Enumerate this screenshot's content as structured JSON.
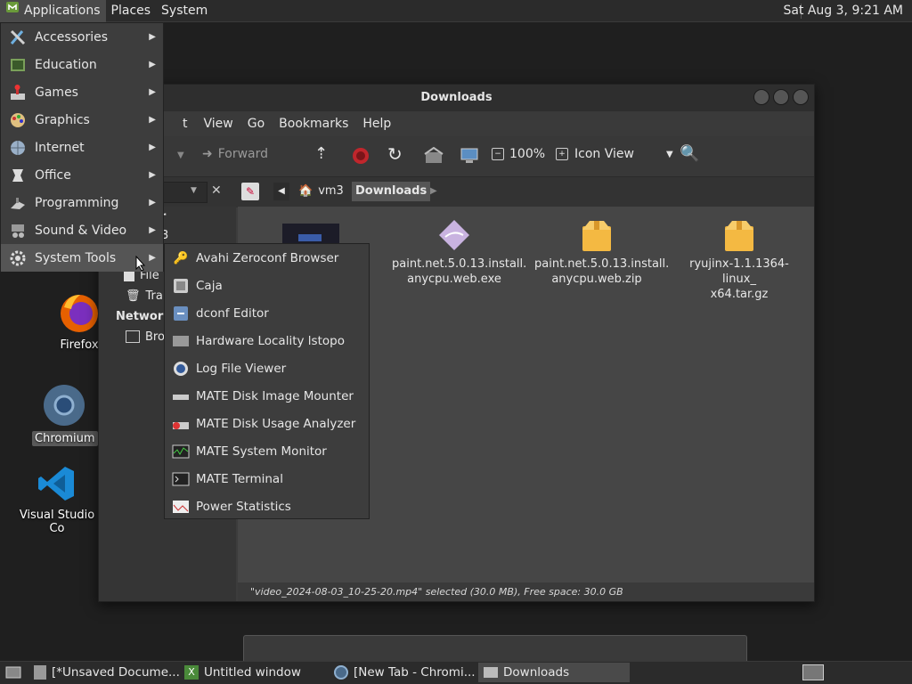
{
  "topbar": {
    "applications": "Applications",
    "places": "Places",
    "system": "System",
    "clock": "Sat Aug  3,  9:21 AM"
  },
  "desktop": {
    "firefox": "Firefox",
    "chromium": "Chromium",
    "vscode": "Visual Studio Co"
  },
  "window": {
    "title": "Downloads",
    "menu": [
      "t",
      "View",
      "Go",
      "Bookmarks",
      "Help"
    ],
    "toolbar": {
      "forward": "Forward",
      "zoom": "100%",
      "view_mode": "Icon View"
    },
    "location": {
      "crumbs": [
        "vm3",
        "Downloads"
      ]
    },
    "sidebar": {
      "items": [
        "er",
        "3",
        "File",
        "Tra"
      ],
      "network_header": "Network",
      "network_item": "Bro"
    },
    "files": [
      {
        "name": "paint.net.5.0.13.install.\nanycpu.web.exe",
        "kind": "exe"
      },
      {
        "name": "paint.net.5.0.13.install.\nanycpu.web.zip",
        "kind": "archive"
      },
      {
        "name": "ryujinx-1.1.1364-linux_\nx64.tar.gz",
        "kind": "archive"
      }
    ],
    "status": "\"video_2024-08-03_10-25-20.mp4\" selected (30.0 MB), Free space: 30.0 GB"
  },
  "appmenu": {
    "items": [
      {
        "label": "Accessories",
        "icon": "accessories-icon"
      },
      {
        "label": "Education",
        "icon": "education-icon"
      },
      {
        "label": "Games",
        "icon": "games-icon"
      },
      {
        "label": "Graphics",
        "icon": "graphics-icon"
      },
      {
        "label": "Internet",
        "icon": "internet-icon"
      },
      {
        "label": "Office",
        "icon": "office-icon"
      },
      {
        "label": "Programming",
        "icon": "programming-icon"
      },
      {
        "label": "Sound & Video",
        "icon": "sound-video-icon"
      },
      {
        "label": "System Tools",
        "icon": "system-tools-icon"
      }
    ]
  },
  "submenu": {
    "items": [
      {
        "label": "Avahi Zeroconf Browser"
      },
      {
        "label": "Caja"
      },
      {
        "label": "dconf Editor"
      },
      {
        "label": "Hardware Locality lstopo"
      },
      {
        "label": "Log File Viewer"
      },
      {
        "label": "MATE Disk Image Mounter"
      },
      {
        "label": "MATE Disk Usage Analyzer"
      },
      {
        "label": "MATE System Monitor"
      },
      {
        "label": "MATE Terminal"
      },
      {
        "label": "Power Statistics"
      }
    ]
  },
  "taskbar": {
    "tasks": [
      "[*Unsaved Docume...",
      "Untitled window",
      "[New Tab - Chromi...",
      "Downloads"
    ]
  }
}
